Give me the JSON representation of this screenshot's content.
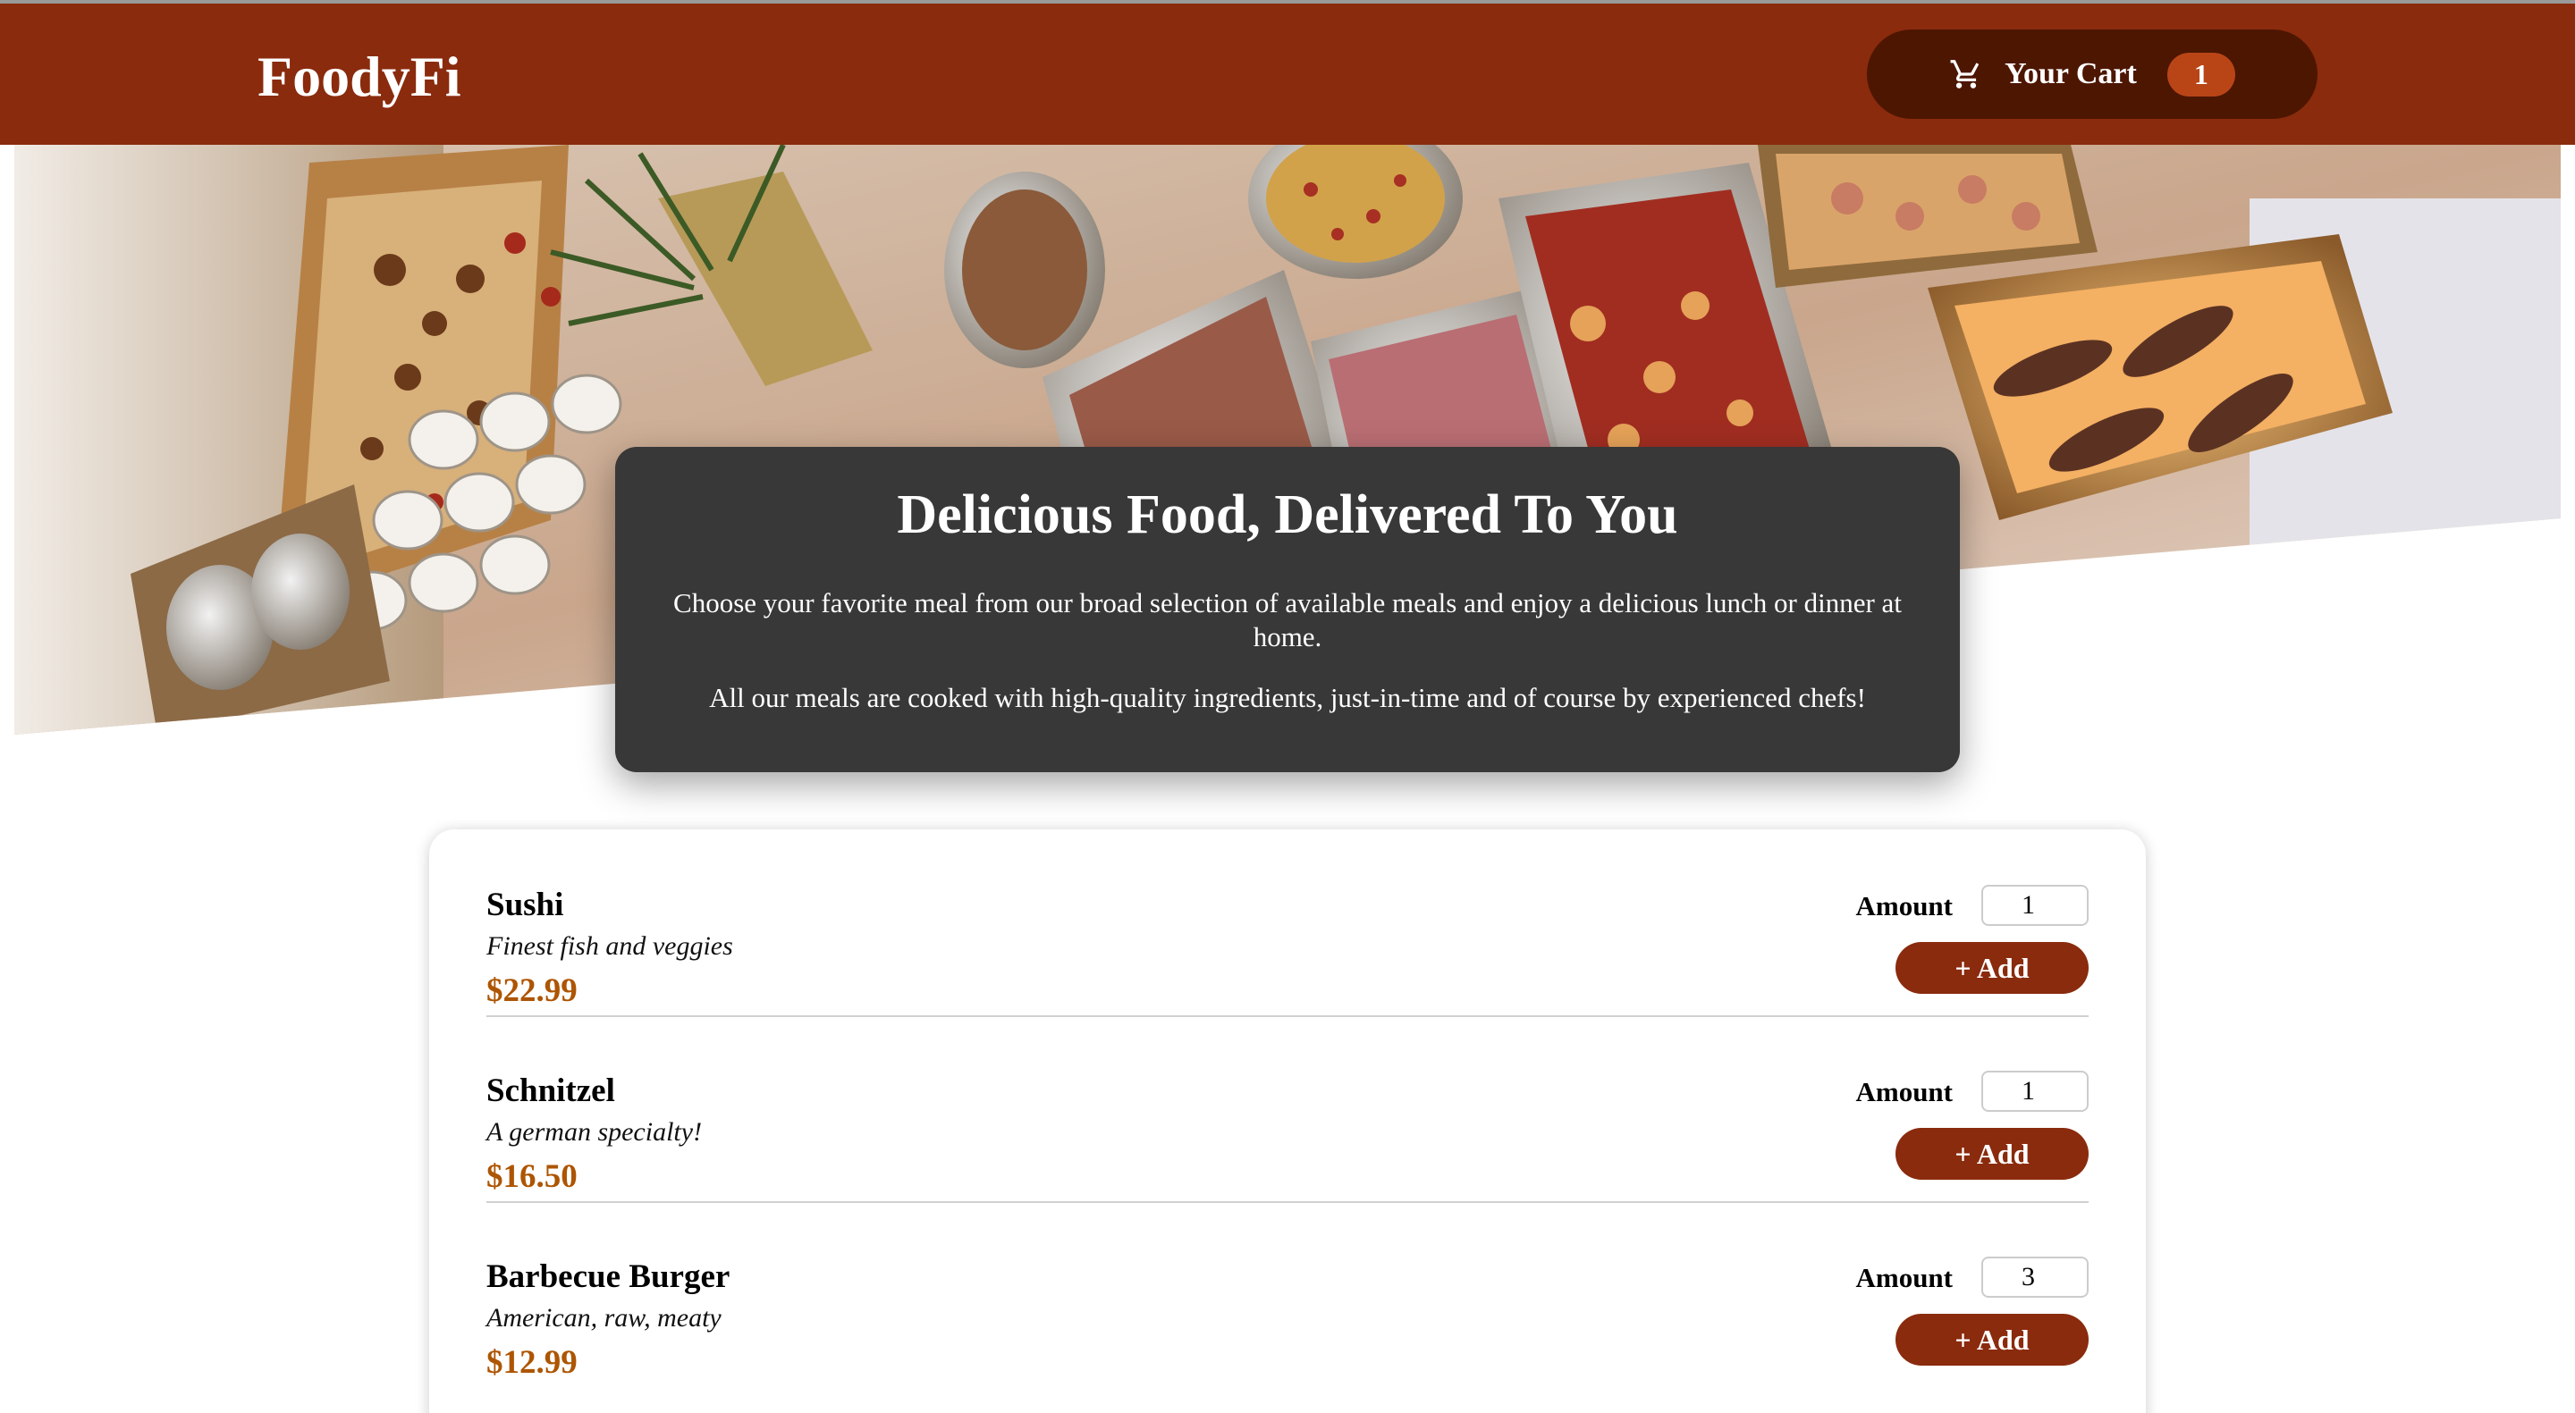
{
  "header": {
    "logo": "FoodyFi",
    "cart_label": "Your Cart",
    "cart_count": "1"
  },
  "hero": {
    "image": "food-buffet-table-photo"
  },
  "summary": {
    "title": "Delicious Food, Delivered To You",
    "paragraph1": "Choose your favorite meal from our broad selection of available meals and enjoy a delicious lunch or dinner at home.",
    "paragraph2": "All our meals are cooked with high-quality ingredients, just-in-time and of course by experienced chefs!"
  },
  "meals": [
    {
      "name": "Sushi",
      "description": "Finest fish and veggies",
      "price": "$22.99",
      "amount_label": "Amount",
      "amount": "1",
      "add_label": "+ Add"
    },
    {
      "name": "Schnitzel",
      "description": "A german specialty!",
      "price": "$16.50",
      "amount_label": "Amount",
      "amount": "1",
      "add_label": "+ Add"
    },
    {
      "name": "Barbecue Burger",
      "description": "American, raw, meaty",
      "price": "$12.99",
      "amount_label": "Amount",
      "amount": "3",
      "add_label": "+ Add"
    }
  ],
  "colors": {
    "header_bg": "#8a2b0d",
    "cart_button_bg": "#4d1601",
    "badge_bg": "#b94517",
    "price": "#ad5502",
    "summary_bg": "#383838"
  }
}
